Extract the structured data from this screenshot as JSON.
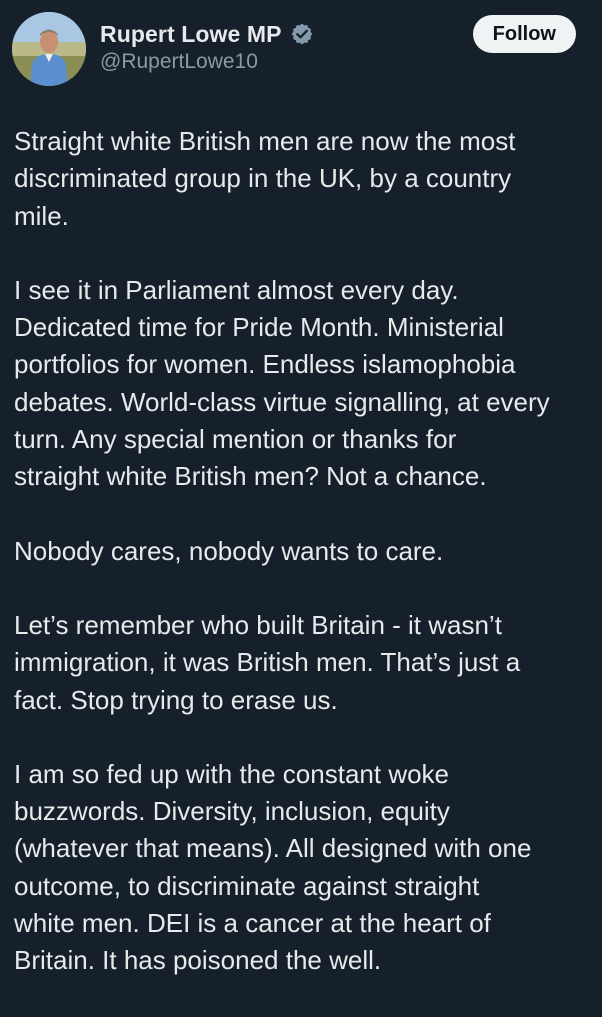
{
  "author": {
    "display_name": "Rupert Lowe MP",
    "handle": "@RupertLowe10",
    "verified_icon": "verified-badge-grey"
  },
  "actions": {
    "follow_label": "Follow"
  },
  "tweet": {
    "paragraphs": [
      "Straight white British men are now the most\ndiscriminated group in the UK, by a country\nmile.",
      "I see it in Parliament almost every day.\nDedicated time for Pride Month. Ministerial\nportfolios for women. Endless islamophobia\ndebates. World-class virtue signalling, at every\nturn. Any special mention or thanks for\nstraight white British men? Not a chance.",
      "Nobody cares, nobody wants to care.",
      "Let’s remember who built Britain - it wasn’t\nimmigration, it was British men. That’s just a\nfact. Stop trying to erase us.",
      "I am so fed up with the constant woke\nbuzzwords. Diversity, inclusion, equity\n(whatever that means). All designed with one\noutcome, to discriminate against straight\nwhite men. DEI is a cancer at the heart of\nBritain. It has poisoned the well."
    ]
  },
  "colors": {
    "background": "#15202b",
    "text_primary": "#e7e9ea",
    "text_secondary": "#8b98a5",
    "follow_bg": "#eff3f4",
    "verified_badge": "#829aab"
  }
}
